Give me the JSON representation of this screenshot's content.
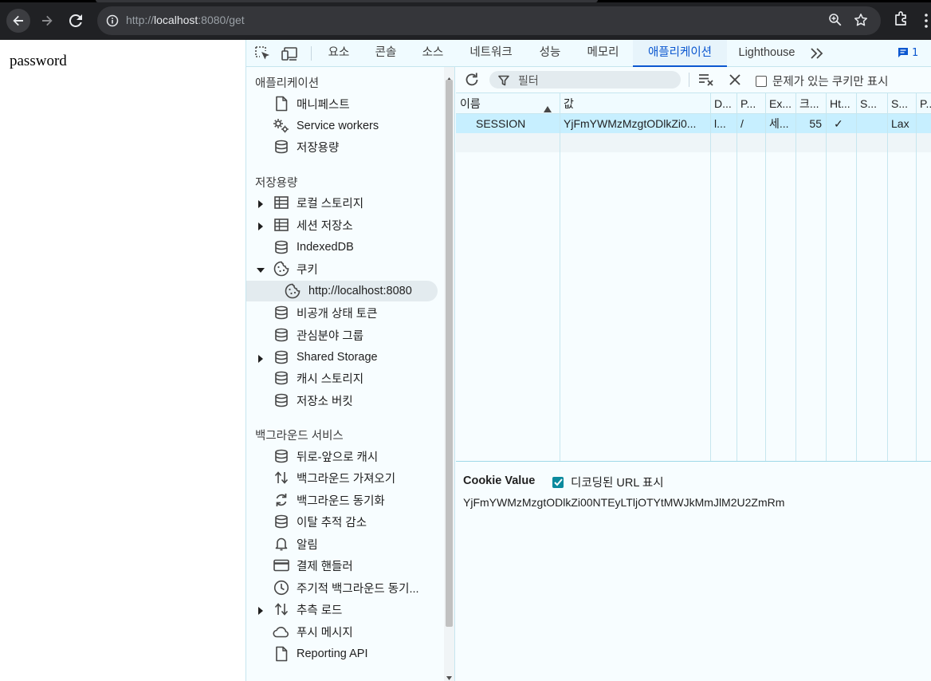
{
  "browser": {
    "url_prefix": "http://",
    "url_host": "localhost",
    "url_rest": ":8080/get"
  },
  "page": {
    "text": "password"
  },
  "devtools": {
    "tabs": [
      "요소",
      "콘솔",
      "소스",
      "네트워크",
      "성능",
      "메모리",
      "애플리케이션",
      "Lighthouse"
    ],
    "active_tab": "애플리케이션",
    "issues_count": "1",
    "sidebar": {
      "section_app": "애플리케이션",
      "app_items": [
        "매니페스트",
        "Service workers",
        "저장용량"
      ],
      "section_storage": "저장용량",
      "storage_items": [
        "로컬 스토리지",
        "세션 저장소",
        "IndexedDB",
        "쿠키",
        "http://localhost:8080",
        "비공개 상태 토큰",
        "관심분야 그룹",
        "Shared Storage",
        "캐시 스토리지",
        "저장소 버킷"
      ],
      "section_bg": "백그라운드 서비스",
      "bg_items": [
        "뒤로-앞으로 캐시",
        "백그라운드 가져오기",
        "백그라운드 동기화",
        "이탈 추적 감소",
        "알림",
        "결제 핸들러",
        "주기적 백그라운드 동기...",
        "추측 로드",
        "푸시 메시지",
        "Reporting API"
      ]
    },
    "cookies": {
      "filter_placeholder": "필터",
      "only_issues_label": "문제가 있는 쿠키만 표시",
      "columns": [
        "이름",
        "값",
        "D...",
        "P...",
        "Ex...",
        "크...",
        "Ht...",
        "S...",
        "S...",
        "P..."
      ],
      "rows": [
        [
          "SESSION",
          "YjFmYWMzMzgtODlkZi0...",
          "l...",
          "/",
          "세...",
          "55",
          "✓",
          "",
          "Lax",
          ""
        ]
      ],
      "value_panel_title": "Cookie Value",
      "decode_label": "디코딩된 URL 표시",
      "cookie_value": "YjFmYWMzMzgtODlkZi00NTEyLTljOTYtMWJkMmJlM2U2ZmRm"
    }
  },
  "colors": {
    "accent": "#0b57d0",
    "selected_row": "#c7efff",
    "chrome_bg": "#202124"
  }
}
